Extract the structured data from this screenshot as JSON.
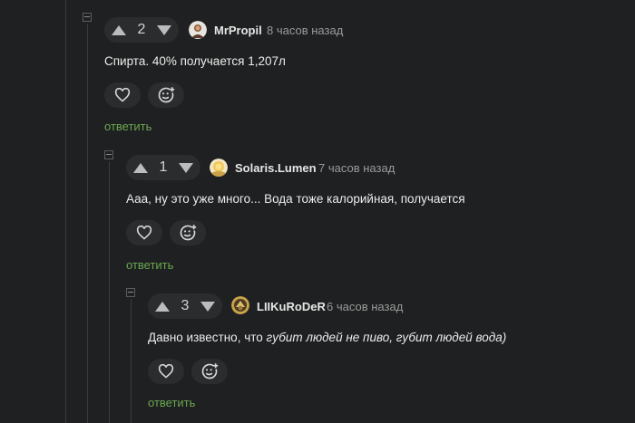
{
  "comments": [
    {
      "votes": "2",
      "author": "MrPropil",
      "time": "8 часов назад",
      "text": "Спирта. 40% получается 1,207л",
      "reply": "ответить"
    },
    {
      "votes": "1",
      "author": "Solaris.Lumen",
      "time": "7 часов назад",
      "text": "Ааа, ну это уже много... Вода тоже калорийная, получается",
      "reply": "ответить"
    },
    {
      "votes": "3",
      "author": "LIIKuRoDeR",
      "time": "6 часов назад",
      "text_plain": "Давно известно, что ",
      "text_italic": "губит людей не пиво, губит людей вода)",
      "reply": "ответить"
    }
  ],
  "colors": {
    "background": "#1f2021",
    "reply_link": "#6aa84f",
    "pill": "#2b2c2e"
  },
  "icons": [
    "arrow-up-icon",
    "arrow-down-icon",
    "heart-icon",
    "emoji-add-icon",
    "collapse-icon"
  ]
}
